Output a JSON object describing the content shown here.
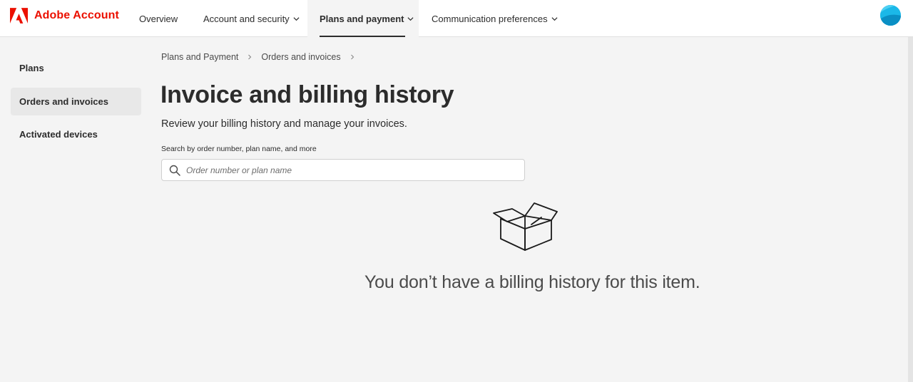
{
  "brand": {
    "name": "Adobe Account",
    "logo_icon": "adobe-logo-icon",
    "color": "#eb1000"
  },
  "nav": {
    "items": [
      {
        "label": "Overview",
        "has_dropdown": false,
        "active": false
      },
      {
        "label": "Account and security",
        "has_dropdown": true,
        "active": false
      },
      {
        "label": "Plans and payment",
        "has_dropdown": true,
        "active": true
      },
      {
        "label": "Communication preferences",
        "has_dropdown": true,
        "active": false
      }
    ]
  },
  "avatar": {
    "icon": "user-avatar",
    "color": "#1bb8e8"
  },
  "sidebar": {
    "items": [
      {
        "label": "Plans",
        "selected": false
      },
      {
        "label": "Orders and invoices",
        "selected": true
      },
      {
        "label": "Activated devices",
        "selected": false
      }
    ]
  },
  "breadcrumb": [
    "Plans and Payment",
    "Orders and invoices"
  ],
  "main": {
    "title": "Invoice and billing history",
    "subtitle": "Review your billing history and manage your invoices.",
    "search": {
      "label": "Search by order number, plan name, and more",
      "placeholder": "Order number or plan name",
      "value": "",
      "icon": "search-icon"
    },
    "empty_state": {
      "icon": "open-box-icon",
      "message": "You don’t have a billing history for this item."
    }
  }
}
